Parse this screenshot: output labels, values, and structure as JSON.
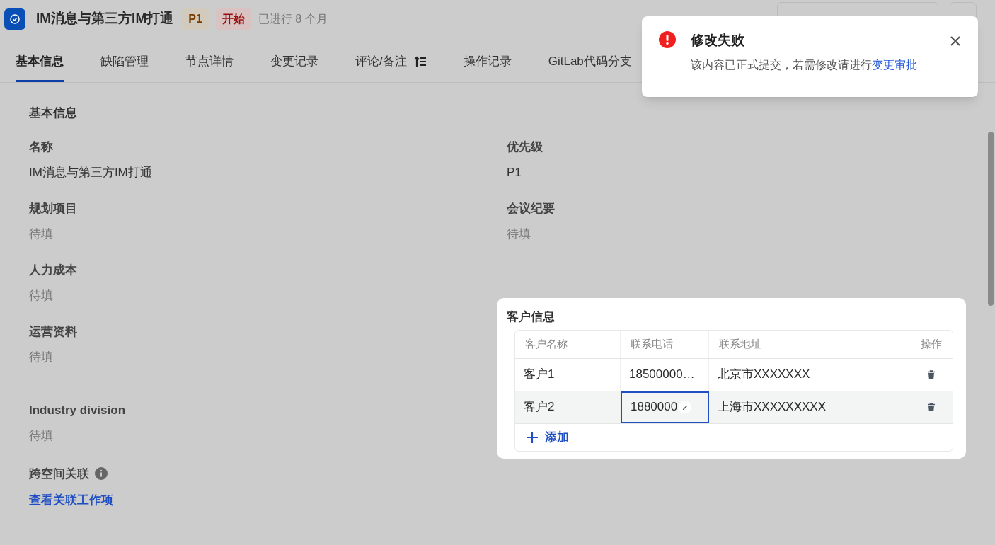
{
  "header": {
    "title": "IM消息与第三方IM打通",
    "priority": "P1",
    "status": "开始",
    "elapsed": "已进行 8 个月"
  },
  "tabs": [
    {
      "label": "基本信息",
      "selected": true
    },
    {
      "label": "缺陷管理",
      "selected": false
    },
    {
      "label": "节点详情",
      "selected": false
    },
    {
      "label": "变更记录",
      "selected": false
    },
    {
      "label": "评论/备注",
      "selected": false,
      "sort_icon": true
    },
    {
      "label": "操作记录",
      "selected": false
    },
    {
      "label": "GitLab代码分支",
      "selected": false
    }
  ],
  "section_title": "基本信息",
  "fields_left": [
    {
      "label": "名称",
      "value": "IM消息与第三方IM打通"
    },
    {
      "label": "规划项目",
      "placeholder": "待填"
    },
    {
      "label": "人力成本",
      "placeholder": "待填"
    },
    {
      "label": "运营资料",
      "placeholder": "待填"
    }
  ],
  "fields_right": [
    {
      "label": "优先级",
      "value": "P1"
    },
    {
      "label": "会议纪要",
      "placeholder": "待填"
    }
  ],
  "industry": {
    "label": "Industry division",
    "placeholder": "待填"
  },
  "cross_space": {
    "label": "跨空间关联",
    "link": "查看关联工作项"
  },
  "customers": {
    "title": "客户信息",
    "columns": [
      "客户名称",
      "联系电话",
      "联系地址",
      "操作"
    ],
    "rows": [
      {
        "name": "客户1",
        "phone": "18500000…",
        "address": "北京市XXXXXXX",
        "editing": false
      },
      {
        "name": "客户2",
        "phone": "1880000",
        "address": "上海市XXXXXXXXX",
        "editing": true
      }
    ],
    "add": "添加"
  },
  "toast": {
    "title": "修改失败",
    "message": "该内容已正式提交，若需修改请进行",
    "link": "变更审批"
  }
}
